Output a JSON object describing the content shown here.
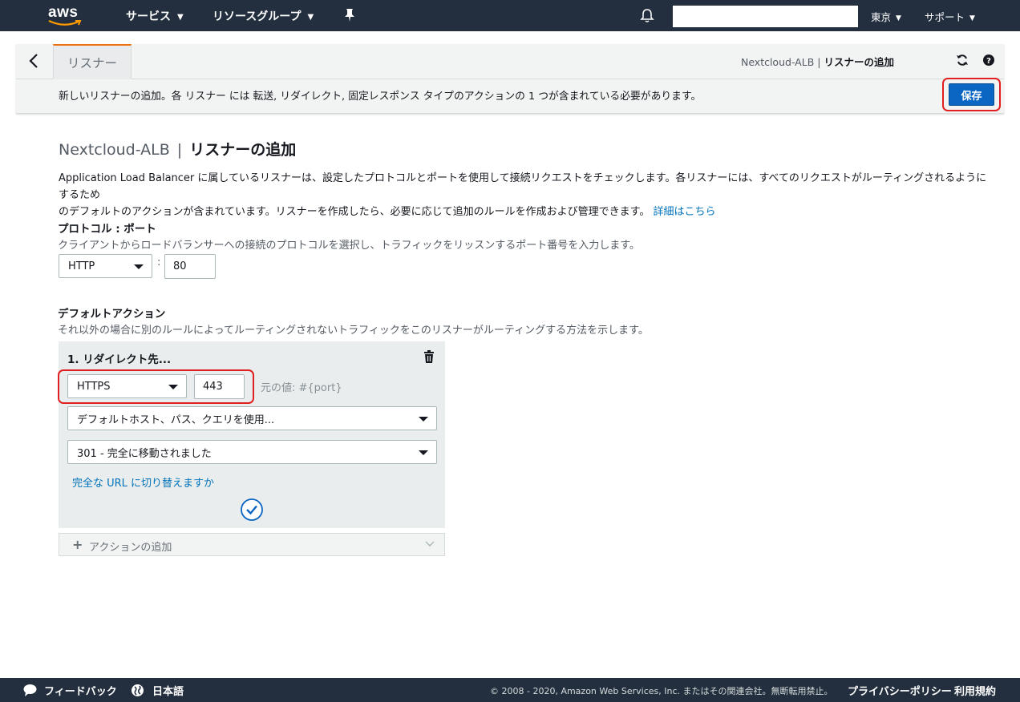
{
  "topnav": {
    "logo": "aws",
    "services_label": "サービス",
    "resource_groups_label": "リソースグループ",
    "search_value": "",
    "region_label": "東京",
    "support_label": "サポート"
  },
  "header": {
    "tab_label": "リスナー",
    "breadcrumb_lb": "Nextcloud-ALB",
    "breadcrumb_sep": "|",
    "breadcrumb_page": "リスナーの追加",
    "notice": "新しいリスナーの追加。各 リスナー には 転送, リダイレクト, 固定レスポンス タイプのアクションの 1 つが含まれている必要があります。",
    "save_label": "保存"
  },
  "main": {
    "title_lb": "Nextcloud-ALB",
    "title_sep": "|",
    "title_page": "リスナーの追加",
    "description_line1": "Application Load Balancer に属しているリスナーは、設定したプロトコルとポートを使用して接続リクエストをチェックします。各リスナーには、すべてのリクエストがルーティングされるようにするため",
    "description_line2": "のデフォルトのアクションが含まれています。リスナーを作成したら、必要に応じて追加のルールを作成および管理できます。",
    "learn_more": "詳細はこちら",
    "protocol": {
      "title": "プロトコル : ポート",
      "description": "クライアントからロードバランサーへの接続のプロトコルを選択し、トラフィックをリッスンするポート番号を入力します。",
      "protocol_value": "HTTP",
      "separator": ":",
      "port_value": "80"
    },
    "default_action": {
      "title": "デフォルトアクション",
      "description": "それ以外の場合に別のルールによってルーティングされないトラフィックをこのリスナーがルーティングする方法を示します。",
      "action_title": "1. リダイレクト先...",
      "redirect_protocol": "HTTPS",
      "redirect_port": "443",
      "original_value_hint": "元の値: #{port}",
      "host_path_query": "デフォルトホスト、パス、クエリを使用...",
      "status_code": "301 - 完全に移動されました",
      "switch_link": "完全な URL に切り替えますか",
      "add_action_label": "アクションの追加"
    }
  },
  "footer": {
    "feedback": "フィードバック",
    "language": "日本語",
    "copyright": "© 2008 - 2020, Amazon Web Services, Inc. またはその関連会社。無断転用禁止。",
    "privacy": "プライバシーポリシー",
    "terms": "利用規約"
  },
  "colors": {
    "nav_bg": "#232f3e",
    "save_button": "#0a66c2",
    "highlight_border": "#e02020",
    "link": "#0073bb",
    "tab_accent": "#ec7211"
  }
}
